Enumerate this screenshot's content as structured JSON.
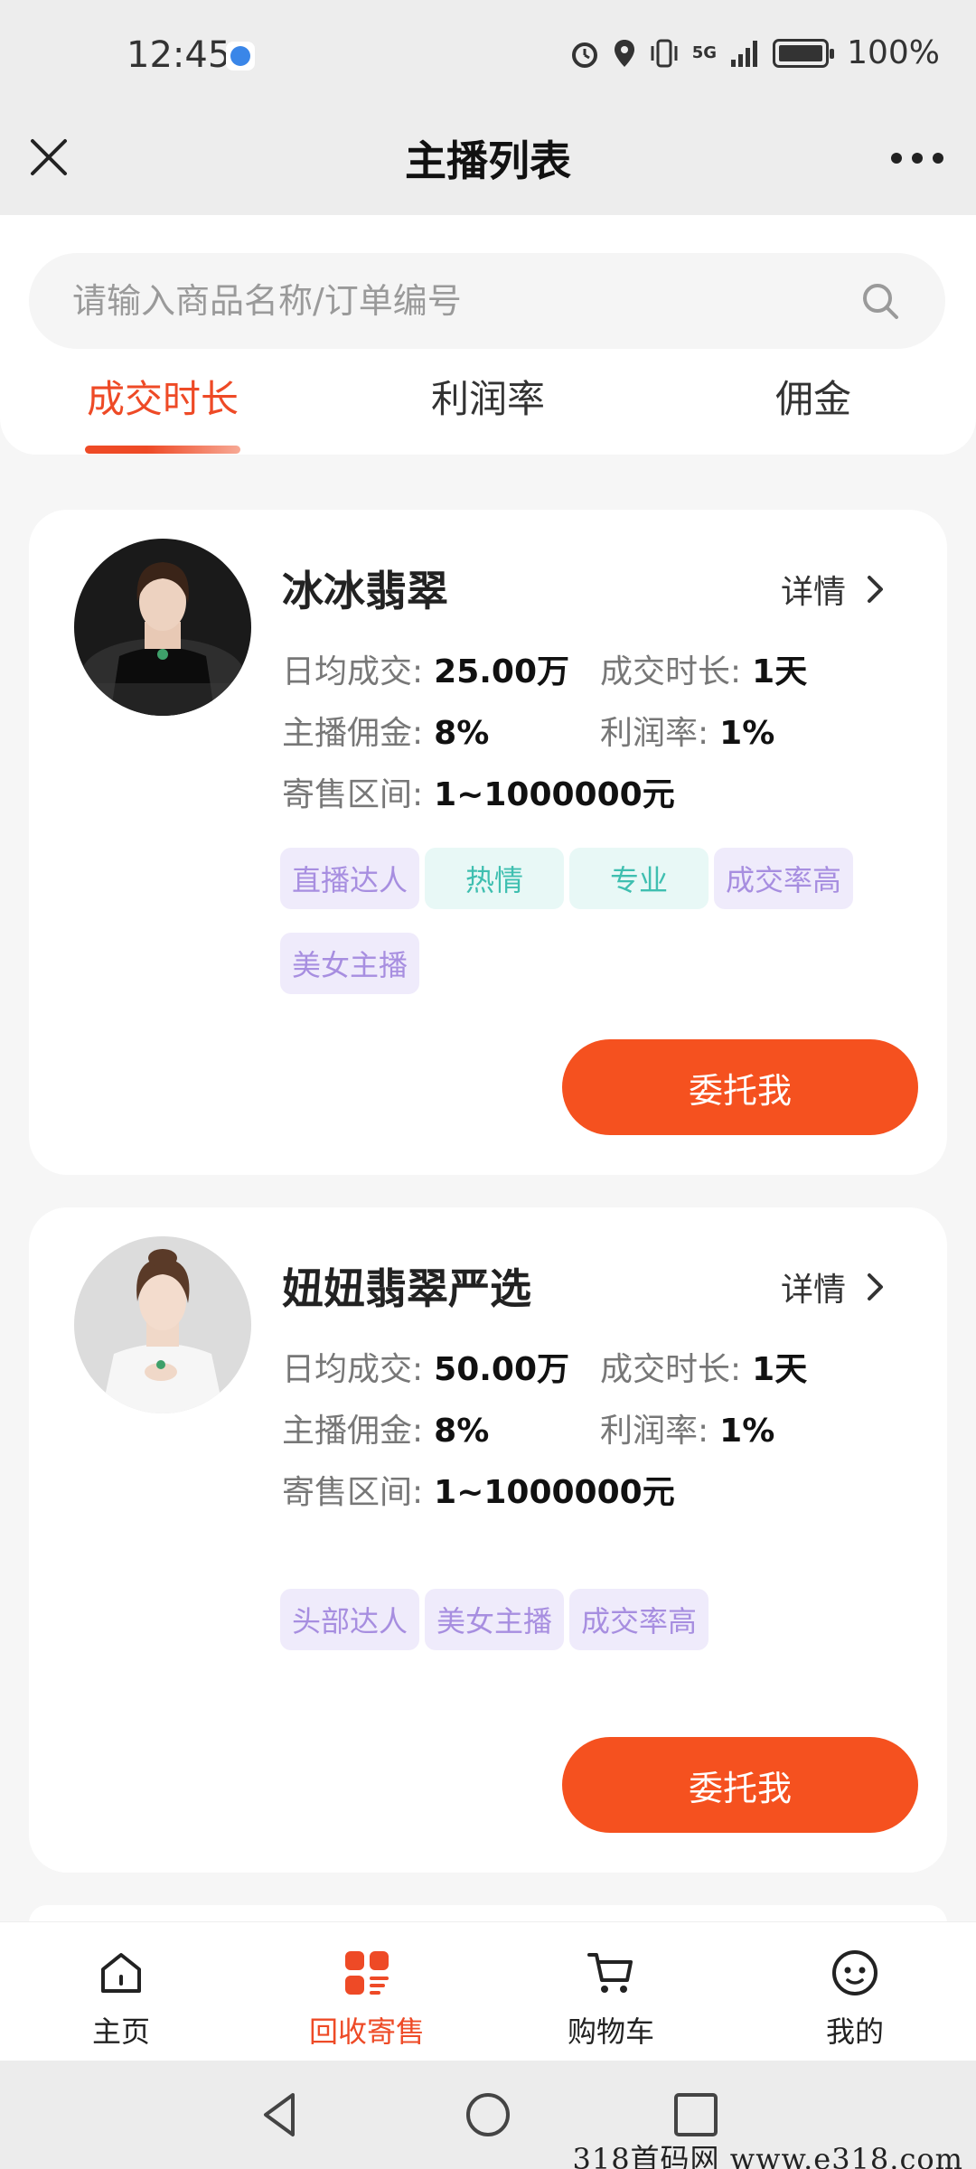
{
  "status_bar": {
    "time": "12:45",
    "network": "5G",
    "battery": "100%"
  },
  "header": {
    "title": "主播列表"
  },
  "search": {
    "placeholder": "请输入商品名称/订单编号"
  },
  "tabs": [
    {
      "label": "成交时长",
      "active": true
    },
    {
      "label": "利润率",
      "active": false
    },
    {
      "label": "佣金",
      "active": false
    }
  ],
  "labels": {
    "daily_deal": "日均成交:",
    "deal_duration": "成交时长:",
    "commission": "主播佣金:",
    "profit_rate": "利润率:",
    "range": "寄售区间:",
    "detail": "详情",
    "entrust": "委托我"
  },
  "streamers": [
    {
      "name": "冰冰翡翠",
      "daily_deal": "25.00万",
      "deal_duration": "1天",
      "commission": "8%",
      "profit_rate": "1%",
      "range": "1~1000000元",
      "tags": [
        {
          "text": "直播达人",
          "color": "purple"
        },
        {
          "text": "热情",
          "color": "teal"
        },
        {
          "text": "专业",
          "color": "teal"
        },
        {
          "text": "成交率高",
          "color": "purple"
        },
        {
          "text": "美女主播",
          "color": "purple"
        }
      ]
    },
    {
      "name": "妞妞翡翠严选",
      "daily_deal": "50.00万",
      "deal_duration": "1天",
      "commission": "8%",
      "profit_rate": "1%",
      "range": "1~1000000元",
      "tags": [
        {
          "text": "头部达人",
          "color": "purple"
        },
        {
          "text": "美女主播",
          "color": "purple"
        },
        {
          "text": "成交率高",
          "color": "purple"
        }
      ]
    }
  ],
  "bottom_nav": [
    {
      "label": "主页",
      "icon": "home-icon",
      "active": false
    },
    {
      "label": "回收寄售",
      "icon": "grid-icon",
      "active": true
    },
    {
      "label": "购物车",
      "icon": "cart-icon",
      "active": false
    },
    {
      "label": "我的",
      "icon": "profile-icon",
      "active": false
    }
  ],
  "watermark": "318首码网  www.e318.com",
  "colors": {
    "accent": "#ee4a26",
    "button": "#f5511f",
    "tag_purple": "#a78ee0",
    "tag_teal": "#3fbfb0"
  }
}
